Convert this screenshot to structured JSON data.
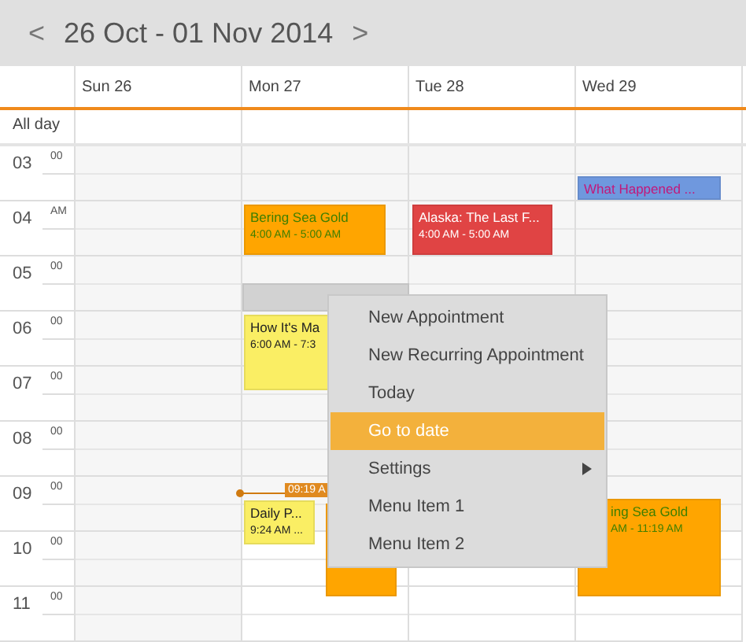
{
  "toolbar": {
    "prev": "<",
    "range": "26 Oct - 01 Nov 2014",
    "next": ">"
  },
  "days": [
    "Sun 26",
    "Mon 27",
    "Tue 28",
    "Wed 29"
  ],
  "all_day_label": "All day",
  "hours": [
    {
      "hour": "03",
      "suffix": "00"
    },
    {
      "hour": "04",
      "suffix": "AM"
    },
    {
      "hour": "05",
      "suffix": "00"
    },
    {
      "hour": "06",
      "suffix": "00"
    },
    {
      "hour": "07",
      "suffix": "00"
    },
    {
      "hour": "08",
      "suffix": "00"
    },
    {
      "hour": "09",
      "suffix": "00"
    },
    {
      "hour": "10",
      "suffix": "00"
    },
    {
      "hour": "11",
      "suffix": "00"
    }
  ],
  "events": [
    {
      "kind": "event",
      "title": "What Happened ...",
      "color": "#6f98de"
    },
    {
      "kind": "event",
      "title": "Bering Sea Gold",
      "time": "4:00 AM - 5:00 AM",
      "color": "#ffa500"
    },
    {
      "kind": "event",
      "title": "Alaska: The Last F...",
      "time": "4:00 AM - 5:00 AM",
      "color": "#e04444"
    },
    {
      "kind": "selection"
    },
    {
      "kind": "event",
      "title": "How It's Ma",
      "time": "6:00 AM - 7:3",
      "color": "#faee64"
    },
    {
      "kind": "event",
      "title": "Daily P...",
      "time": "9:24 AM ...",
      "color": "#faee64"
    },
    {
      "kind": "event",
      "color": "#ffa500"
    },
    {
      "kind": "event",
      "title": "ing Sea Gold",
      "time": "AM - 11:19 AM",
      "color": "#ffa500"
    }
  ],
  "now_marker": "09:19 A",
  "context_menu": [
    {
      "label": "New Appointment",
      "selected": false,
      "submenu": false
    },
    {
      "label": "New Recurring Appointment",
      "selected": false,
      "submenu": false
    },
    {
      "label": "Today",
      "selected": false,
      "submenu": false
    },
    {
      "label": "Go to date",
      "selected": true,
      "submenu": false
    },
    {
      "label": "Settings",
      "selected": false,
      "submenu": true
    },
    {
      "label": "Menu Item 1",
      "selected": false,
      "submenu": false
    },
    {
      "label": "Menu Item 2",
      "selected": false,
      "submenu": false
    }
  ]
}
